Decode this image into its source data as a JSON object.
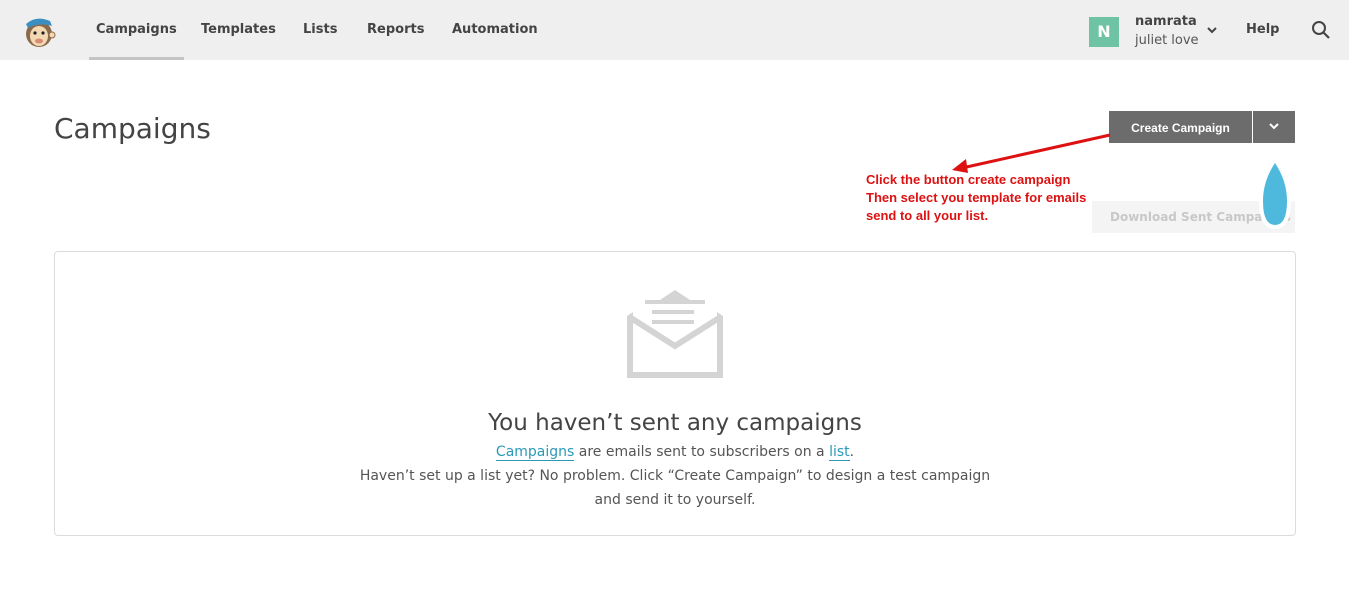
{
  "nav": {
    "items": [
      {
        "label": "Campaigns",
        "active": true
      },
      {
        "label": "Templates"
      },
      {
        "label": "Lists"
      },
      {
        "label": "Reports"
      },
      {
        "label": "Automation"
      }
    ],
    "user": {
      "initial": "N",
      "name": "namrata",
      "org": "juliet love"
    },
    "help_label": "Help",
    "icons": [
      "logo-icon",
      "chevron-down-icon",
      "search-icon"
    ]
  },
  "page": {
    "title": "Campaigns",
    "create_button": "Create Campaign",
    "download_button": "Download Sent Campaigns"
  },
  "annotation": {
    "line1": "Click the button create campaign",
    "line2": "Then select you template for emails",
    "line3": "send to all your list.",
    "color": "#dd1111"
  },
  "empty_state": {
    "title": "You haven’t sent any campaigns",
    "link_campaigns": "Campaigns",
    "text_mid": " are emails sent to subscribers on a ",
    "link_list": "list",
    "text_end": ".",
    "line2": "Haven’t set up a list yet? No problem. Click “Create Campaign” to design a test campaign",
    "line3": "and send it to yourself."
  },
  "colors": {
    "link": "#2a9ab8",
    "button": "#6c6c6c",
    "avatar": "#6dc3a3"
  }
}
